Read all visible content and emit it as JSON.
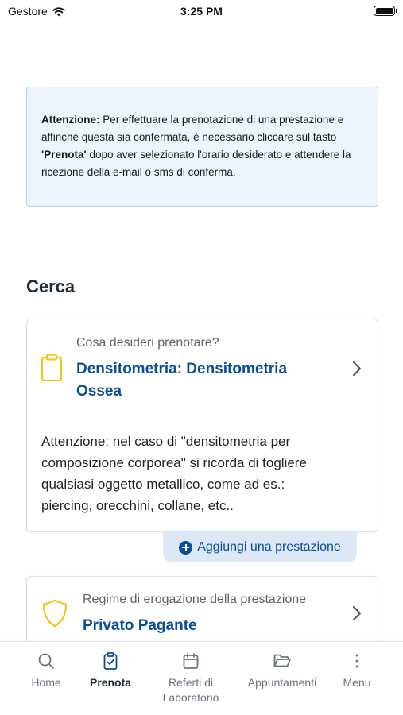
{
  "status_bar": {
    "carrier": "Gestore",
    "time": "3:25 PM"
  },
  "alert": {
    "bold_prefix": "Attenzione:",
    "text_1": " Per effettuare la prenotazione di una prestazione e affinchè questa sia confermata, è necessario cliccare sul tasto ",
    "bold_button": "'Prenota'",
    "text_2": " dopo aver selezionato l'orario desiderato e attendere la ricezione della e-mail o sms di conferma."
  },
  "search": {
    "title": "Cerca",
    "service_card": {
      "label": "Cosa desideri prenotare?",
      "value": "Densitometria: Densitometria Ossea",
      "note": "Attenzione: nel caso di \"densitometria per composizione corporea\" si ricorda di togliere qualsiasi oggetto metallico, come ad es.: piercing, orecchini, collane, etc..",
      "icon": "clipboard-icon",
      "icon_color": "#f5c518"
    },
    "add_button_label": "Aggiungi una prestazione",
    "regime_card": {
      "label": "Regime di erogazione della prestazione",
      "value": "Privato Pagante",
      "icon": "shield-icon",
      "icon_color": "#f5c518"
    }
  },
  "tabs": [
    {
      "label": "Home",
      "icon": "search-icon",
      "active": false
    },
    {
      "label": "Prenota",
      "icon": "clipboard-check-icon",
      "active": true
    },
    {
      "label": "Referti di Laboratorio",
      "icon": "calendar-icon",
      "active": false
    },
    {
      "label": "Appuntamenti",
      "icon": "folder-open-icon",
      "active": false
    },
    {
      "label": "Menu",
      "icon": "more-vertical-icon",
      "active": false
    }
  ],
  "colors": {
    "accent": "#0b4e96",
    "alert_bg": "#eef4fd",
    "alert_border": "#b8cdeb",
    "icon_yellow": "#f5c518"
  }
}
